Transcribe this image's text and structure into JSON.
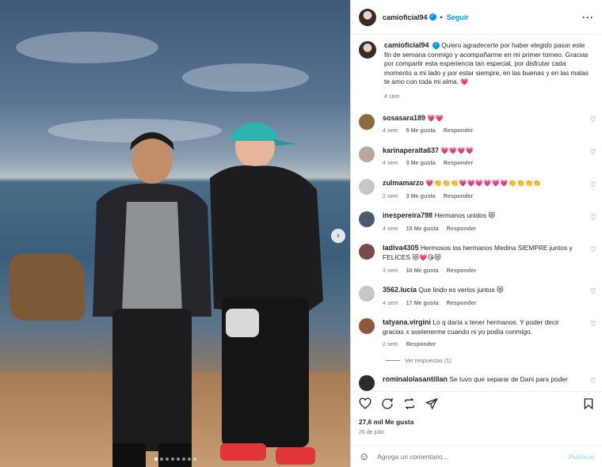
{
  "post": {
    "username": "camioficial94",
    "follow_label": "Seguir",
    "more_icon": "more-icon",
    "caption": "Quiero agradecerte por haber elegido pasar este fin de semana conmigo y acompañarme en mi primer torneo. Gracias por compartir esta experiencia tan especial, por disfrutar cada momento a mi lado y por estar siempre, en las buenas y en las malas te amo con toda mi alma. 💗",
    "caption_time": "4 sem",
    "likes": "27,6 mil Me gusta",
    "date": "26 de julio",
    "comment_placeholder": "Agrega un comentario...",
    "publish_label": "Publicar"
  },
  "comments": [
    {
      "user": "sosasara189",
      "text": "💗💗",
      "time": "4 sem",
      "likes": "5 Me gusta",
      "reply": "Responder",
      "avatar_color": "#8a6a3e"
    },
    {
      "user": "karinaperalta637",
      "text": "💗💗💗💗",
      "time": "4 sem",
      "likes": "3 Me gusta",
      "reply": "Responder",
      "avatar_color": "#b9a79a"
    },
    {
      "user": "zulmamarzo",
      "text": "💗👏👏👏💗💗💗💗💗💗👏👏👏👏",
      "time": "2 sem",
      "likes": "3 Me gusta",
      "reply": "Responder",
      "avatar_color": "#c7c7c7"
    },
    {
      "user": "inespereira798",
      "text": "Hermanos unidos 😻",
      "time": "4 sem",
      "likes": "15 Me gusta",
      "reply": "Responder",
      "avatar_color": "#4d5a6b"
    },
    {
      "user": "ladiva4305",
      "text": "Hermosos los hermanos Medina SIEMPRE juntos y FELICES 😻💗😘😻",
      "time": "3 sem",
      "likes": "10 Me gusta",
      "reply": "Responder",
      "avatar_color": "#7a4a4a"
    },
    {
      "user": "3562.lucia",
      "text": "Que lindo es verlos juntos 😻",
      "time": "4 sem",
      "likes": "17 Me gusta",
      "reply": "Responder",
      "avatar_color": "#c7c7c7"
    },
    {
      "user": "tatyana.virgini",
      "text": "Lo q daría x tener hermanos. Y poder decir gracias x sostenerme cuando ni yo podía conmigo.",
      "time": "2 sem",
      "likes": "",
      "reply": "Responder",
      "avatar_color": "#8a5a3a"
    },
    {
      "user": "rominalolasantillan",
      "text": "Se tuvo que separar de Dani para poder",
      "time": "",
      "likes": "",
      "reply": "",
      "avatar_color": "#2d2d2d"
    }
  ],
  "view_replies": "Ver respuestas (1)"
}
